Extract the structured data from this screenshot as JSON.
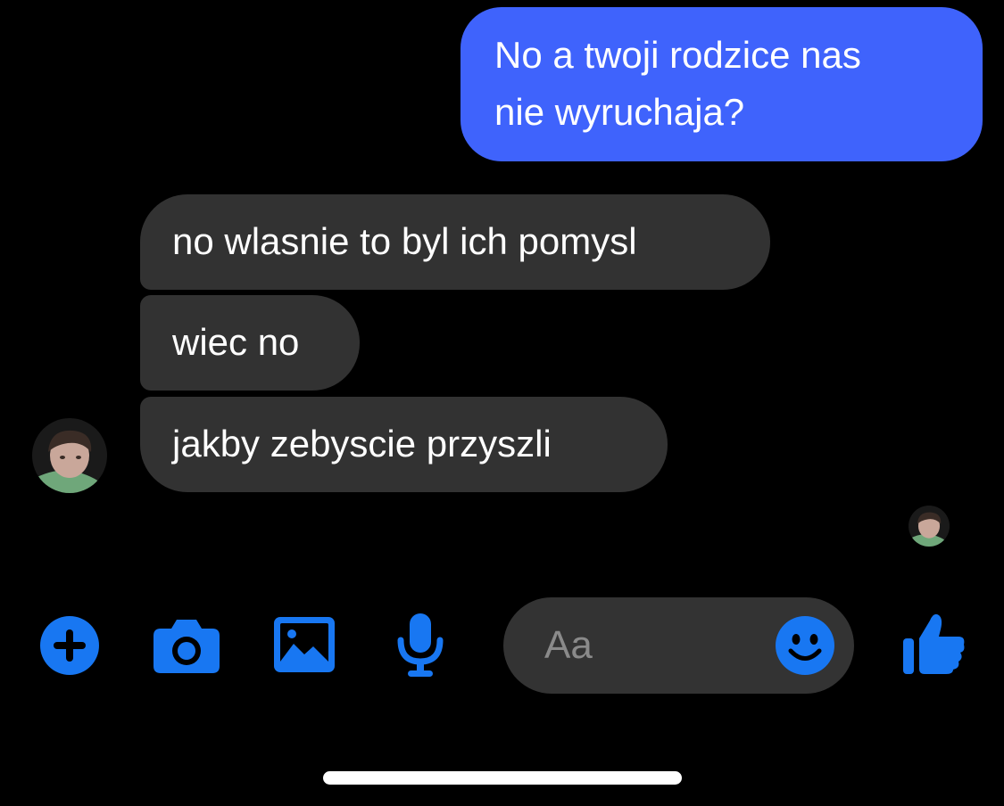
{
  "messages": {
    "outgoing": [
      {
        "line1": "No a twoji rodzice nas",
        "line2": "nie wyruchaja?"
      }
    ],
    "incoming": [
      "no wlasnie to byl ich pomysl",
      "wiec no",
      "jakby zebyscie przyszli"
    ]
  },
  "composer": {
    "placeholder": "Aa"
  },
  "icons": {
    "toolbar": [
      "plus-icon",
      "camera-icon",
      "gallery-icon",
      "microphone-icon"
    ],
    "composer": "emoji-icon",
    "send": "thumbs-up-icon"
  },
  "colors": {
    "background": "#000000",
    "outgoing_bubble": "#3f63fc",
    "incoming_bubble": "#323232",
    "accent": "#1877f2",
    "composer_field": "#333333"
  }
}
